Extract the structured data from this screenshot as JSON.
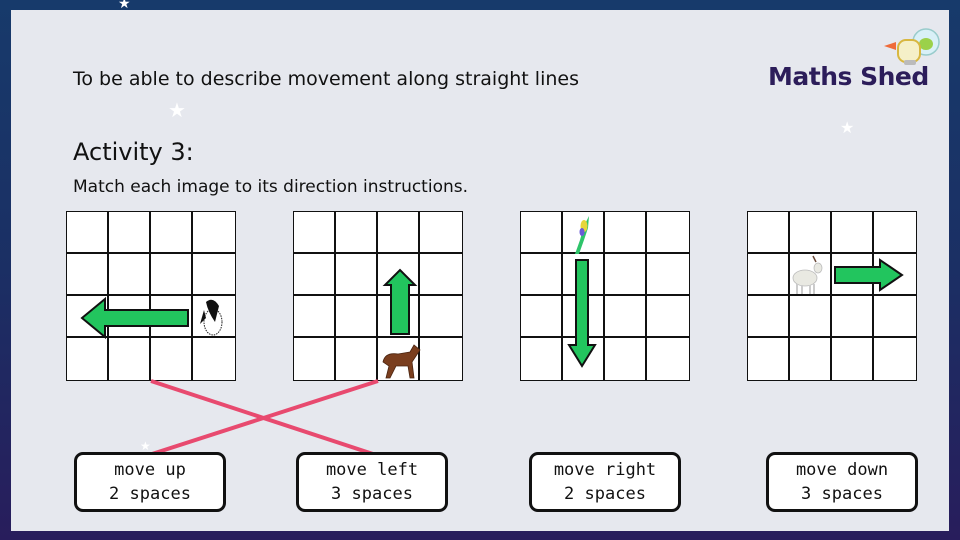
{
  "slide": {
    "objective": "To be able to describe movement along straight lines",
    "logo_text": "Maths Shed",
    "logo_icon": "astronaut-mascot-icon",
    "activity_heading": "Activity 3:",
    "instruction": "Match each image to its direction instructions."
  },
  "grids": [
    {
      "animal": "penguin",
      "icon": "penguin-icon",
      "arrow_direction": "left",
      "arrow_length_spaces": 3
    },
    {
      "animal": "horse",
      "icon": "horse-icon",
      "arrow_direction": "up",
      "arrow_length_spaces": 2
    },
    {
      "animal": "parrot",
      "icon": "parrot-icon",
      "arrow_direction": "down",
      "arrow_length_spaces": 3
    },
    {
      "animal": "goat",
      "icon": "goat-icon",
      "arrow_direction": "right",
      "arrow_length_spaces": 2
    }
  ],
  "cards": [
    {
      "line1": "move up",
      "line2": "2 spaces"
    },
    {
      "line1": "move left",
      "line2": "3 spaces"
    },
    {
      "line1": "move right",
      "line2": "2 spaces"
    },
    {
      "line1": "move down",
      "line2": "3 spaces"
    }
  ],
  "matches": [
    {
      "grid": 0,
      "card": 1
    },
    {
      "grid": 1,
      "card": 0
    }
  ],
  "colors": {
    "arrow_fill": "#22c55e",
    "match_line": "#e84a6f",
    "logo": "#2c1d5a"
  }
}
